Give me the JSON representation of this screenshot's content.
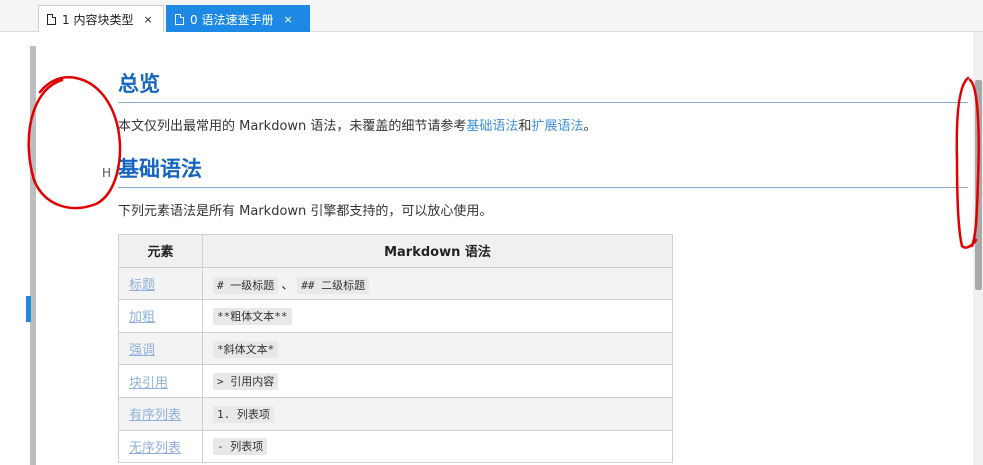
{
  "tabs": [
    {
      "label": "1 内容块类型",
      "close": "×",
      "active": false
    },
    {
      "label": "0 语法速查手册",
      "close": "×",
      "active": true
    }
  ],
  "gutter": {
    "heading_marker": "H"
  },
  "overview": {
    "title": "总览",
    "text_before": "本文仅列出最常用的 Markdown 语法，未覆盖的细节请参考",
    "link1": "基础语法",
    "text_mid": "和",
    "link2": "扩展语法",
    "text_after": "。"
  },
  "basic": {
    "title": "基础语法",
    "intro": "下列元素语法是所有 Markdown 引擎都支持的，可以放心使用。",
    "table": {
      "headers": [
        "元素",
        "Markdown 语法"
      ],
      "rows": [
        {
          "element": "标题",
          "syntax": [
            "# 一级标题",
            "## 二级标题"
          ],
          "separator": "、"
        },
        {
          "element": "加粗",
          "syntax": [
            "**粗体文本**"
          ]
        },
        {
          "element": "强调",
          "syntax": [
            "*斜体文本*"
          ]
        },
        {
          "element": "块引用",
          "syntax": [
            "> 引用内容"
          ]
        },
        {
          "element": "有序列表",
          "syntax": [
            "1. 列表项"
          ]
        },
        {
          "element": "无序列表",
          "syntax": [
            "- 列表项"
          ]
        }
      ]
    }
  },
  "colors": {
    "accent": "#1e88e5",
    "heading": "#1565c0",
    "link": "#3f8fd8",
    "annotation": "#e00000"
  }
}
